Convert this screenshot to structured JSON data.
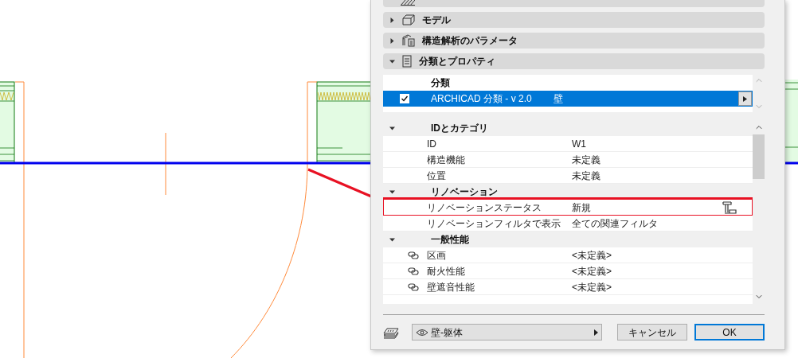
{
  "sections": [
    {
      "title": "モデル",
      "expanded": false
    },
    {
      "title": "構造解析のパラメータ",
      "expanded": false
    },
    {
      "title": "分類とプロパティ",
      "expanded": true
    }
  ],
  "classification": {
    "header": "分類",
    "rows": [
      {
        "checked": true,
        "selected": true,
        "system": "ARCHICAD 分類 - v 2.0",
        "value": "壁"
      }
    ]
  },
  "properties": [
    {
      "title": "IDとカテゴリ",
      "expanded": true,
      "children": [
        {
          "label": "ID",
          "value": "W1",
          "linked": false,
          "highlighted": false,
          "override_icon": false
        },
        {
          "label": "構造機能",
          "value": "未定義",
          "linked": false,
          "highlighted": false,
          "override_icon": false
        },
        {
          "label": "位置",
          "value": "未定義",
          "linked": false,
          "highlighted": false,
          "override_icon": false
        }
      ]
    },
    {
      "title": "リノベーション",
      "expanded": true,
      "children": [
        {
          "label": "リノベーションステータス",
          "value": "新規",
          "linked": false,
          "highlighted": true,
          "override_icon": true
        },
        {
          "label": "リノベーションフィルタで表示",
          "value": "全ての関連フィルタ",
          "linked": false,
          "highlighted": false,
          "override_icon": false
        }
      ]
    },
    {
      "title": "一般性能",
      "expanded": true,
      "children": [
        {
          "label": "区画",
          "value": "<未定義>",
          "linked": true,
          "highlighted": false,
          "override_icon": false
        },
        {
          "label": "耐火性能",
          "value": "<未定義>",
          "linked": true,
          "highlighted": false,
          "override_icon": false
        },
        {
          "label": "壁遮音性能",
          "value": "<未定義>",
          "linked": true,
          "highlighted": false,
          "override_icon": false
        }
      ]
    }
  ],
  "footer": {
    "layer": "壁-躯体",
    "buttons": [
      {
        "label": "キャンセル",
        "kind": "secondary"
      },
      {
        "label": "OK",
        "kind": "default"
      }
    ]
  }
}
